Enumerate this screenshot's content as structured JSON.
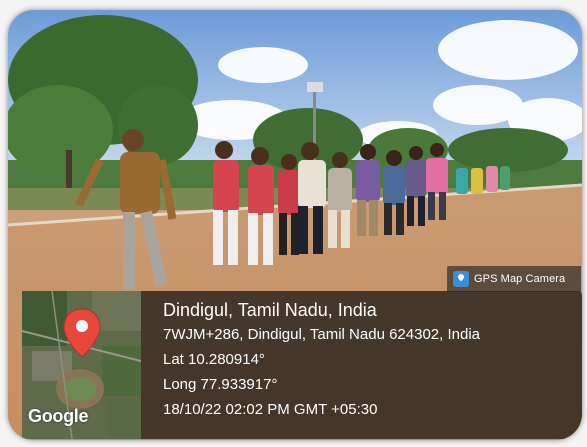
{
  "gps_app": {
    "app_icon": "map-camera-icon",
    "app_name": "GPS Map Camera"
  },
  "location": {
    "place": "Dindigul, Tamil Nadu, India",
    "address": "7WJM+286, Dindigul, Tamil Nadu 624302, India",
    "latitude": "Lat 10.280914°",
    "longitude": "Long 77.933917°",
    "datetime": "18/10/22 02:02 PM GMT +05:30"
  },
  "map": {
    "logo_text": "Google",
    "pin_icon": "location-pin-icon",
    "pin_color": "#e8483c"
  }
}
